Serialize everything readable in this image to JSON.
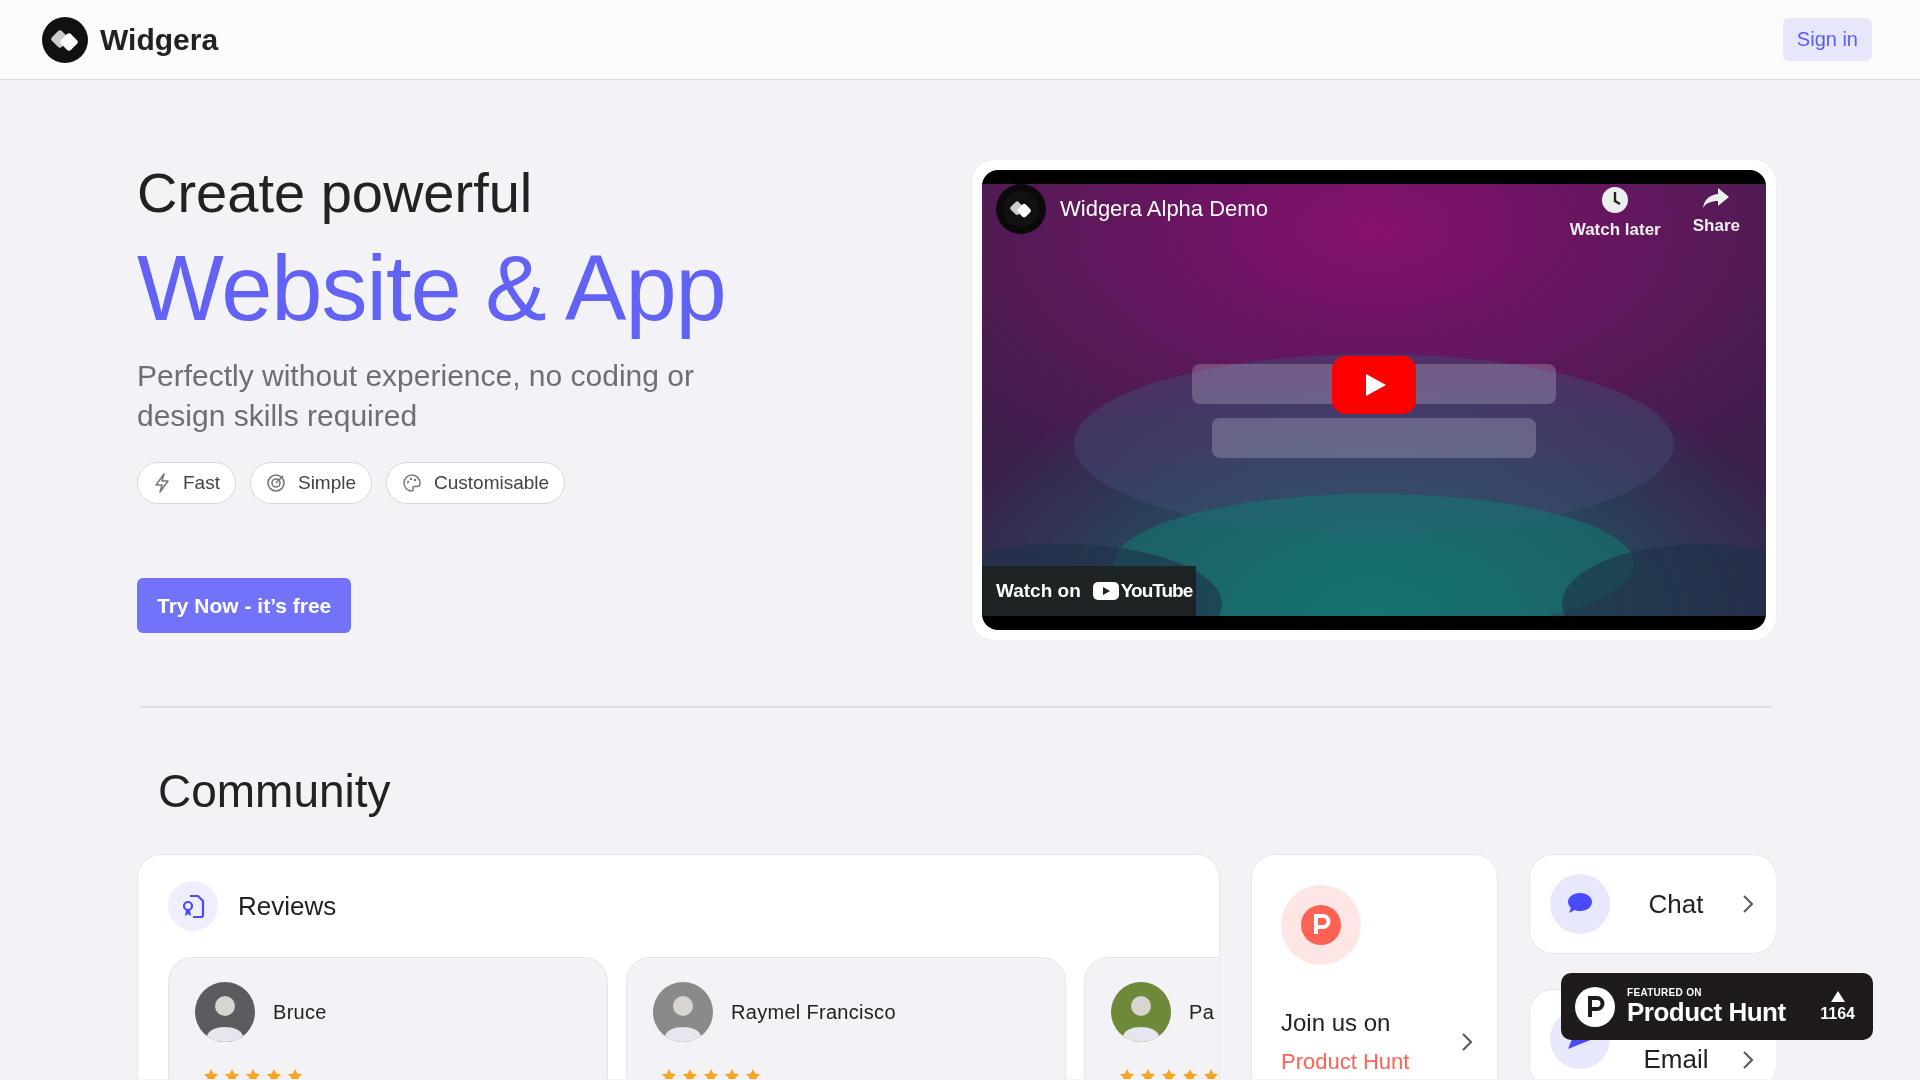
{
  "header": {
    "brand": "Widgera",
    "sign_in": "Sign in"
  },
  "hero": {
    "headline": "Create powerful",
    "highlight": "Website & App",
    "subtitle": "Perfectly without experience, no coding or design skills required",
    "features": [
      {
        "kind": "bolt",
        "label": "Fast"
      },
      {
        "kind": "target",
        "label": "Simple"
      },
      {
        "kind": "palette",
        "label": "Customisable"
      }
    ],
    "cta": "Try Now - it’s free"
  },
  "video": {
    "title": "Widgera Alpha Demo",
    "actions": [
      {
        "kind": "clock",
        "label": "Watch later"
      },
      {
        "kind": "share",
        "label": "Share"
      }
    ],
    "watch_on": "Watch on",
    "platform": "YouTube"
  },
  "community": {
    "title": "Community",
    "reviews": {
      "title": "Reviews",
      "items": [
        {
          "name": "Bruce",
          "stars": 5
        },
        {
          "name": "Raymel Francisco",
          "stars": 5
        },
        {
          "name": "Pa",
          "stars": 5
        }
      ]
    },
    "product_hunt": {
      "line1": "Join us on",
      "line2": "Product Hunt"
    },
    "contacts": [
      {
        "kind": "chat",
        "label": "Chat"
      },
      {
        "kind": "email",
        "label": "Email"
      }
    ]
  },
  "badge": {
    "caption": "FEATURED ON",
    "name": "Product Hunt",
    "votes": "1164"
  }
}
